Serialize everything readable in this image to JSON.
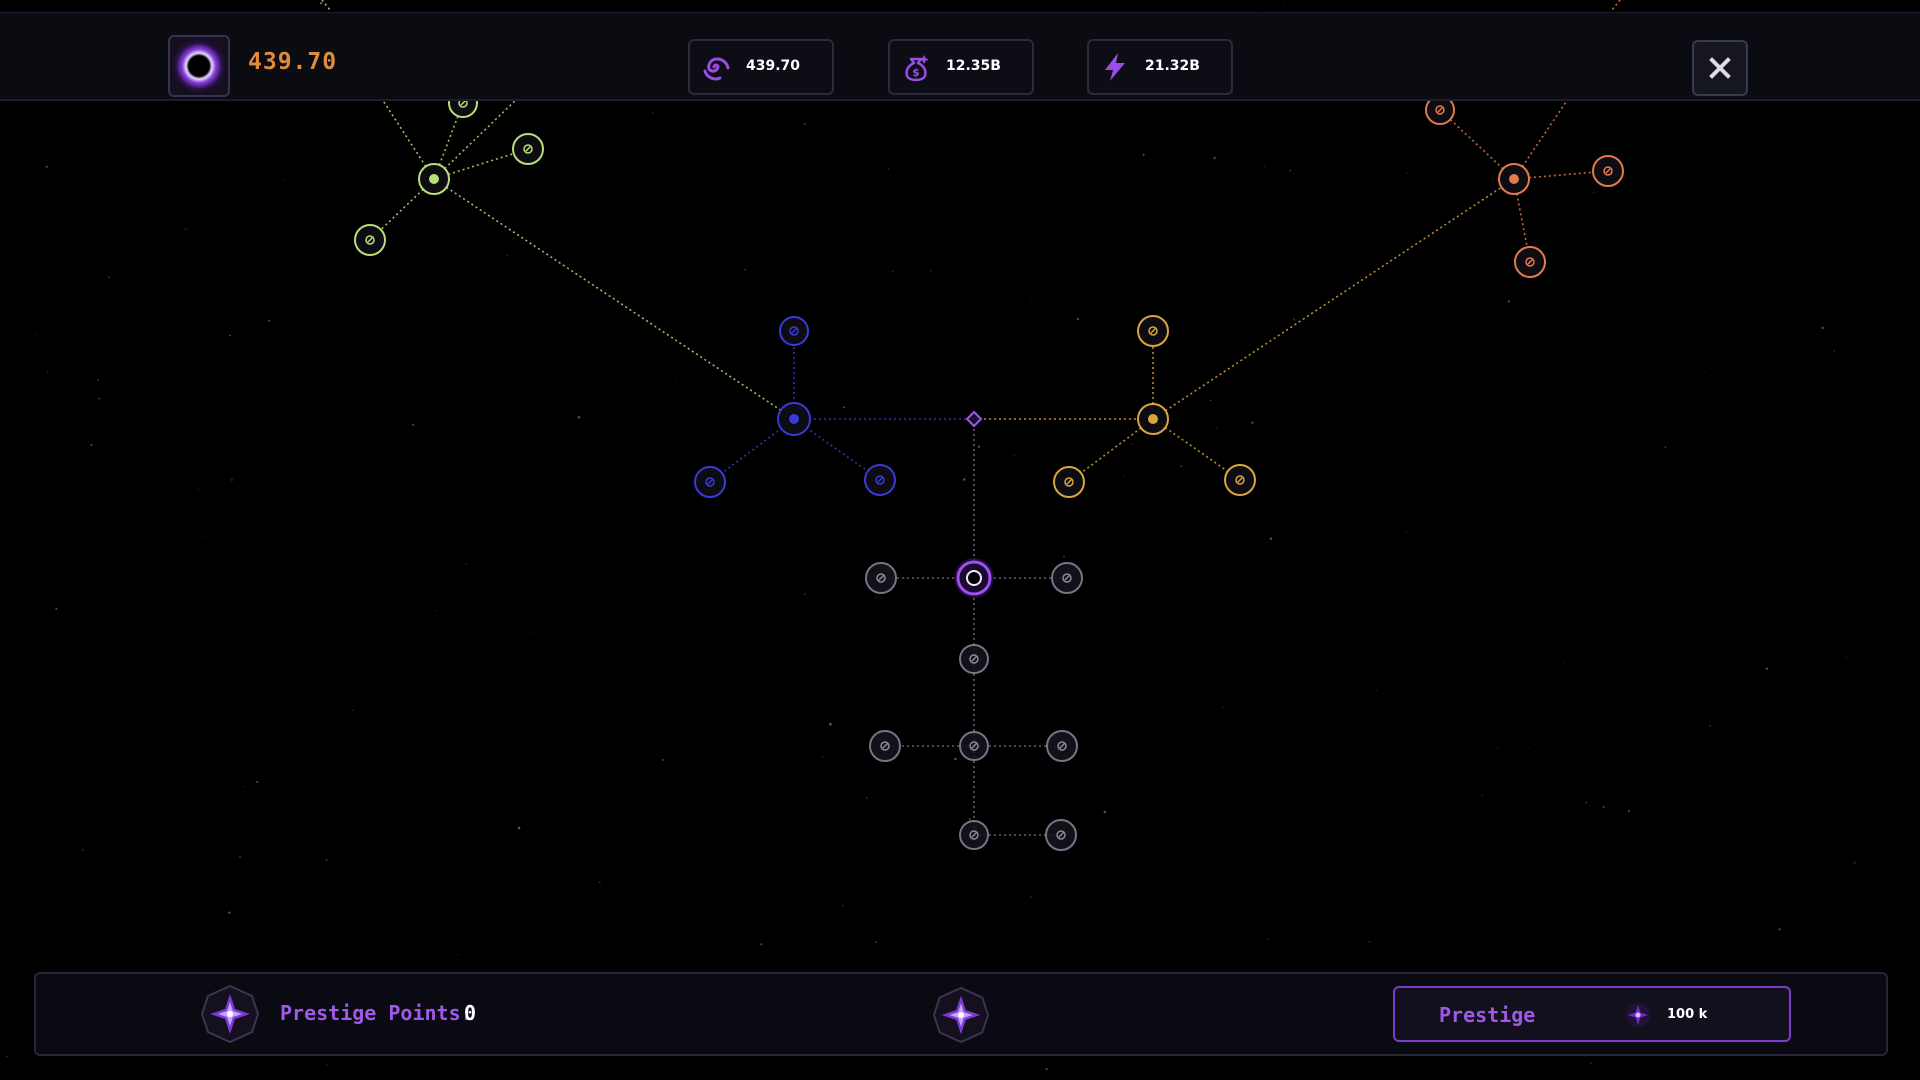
{
  "header": {
    "currency_value": "439.70",
    "resources": [
      {
        "id": "dark-matter",
        "icon": "swirl-galaxy-icon",
        "value": "439.70"
      },
      {
        "id": "money",
        "icon": "money-bag-icon",
        "value": "12.35B"
      },
      {
        "id": "energy",
        "icon": "lightning-icon",
        "value": "21.32B"
      }
    ],
    "close_icon": "close-icon"
  },
  "footer": {
    "prestige_points_label": "Prestige Points:",
    "prestige_points_value": "0",
    "prestige_button_label": "Prestige",
    "prestige_cost": "100 k"
  },
  "colors": {
    "accent_purple": "#9f58e8",
    "currency_orange": "#e08a3c",
    "branch_green": "#b8df78",
    "branch_blue": "#3a3ad8",
    "branch_gold": "#d9a63c",
    "branch_orange": "#e57a4a",
    "branch_neutral": "#8a8aa0"
  },
  "skill_tree": {
    "branches": [
      {
        "name": "green",
        "color": "#b8df78",
        "node_count": 5
      },
      {
        "name": "blue",
        "color": "#3a3ad8",
        "node_count": 4
      },
      {
        "name": "gold",
        "color": "#d9a63c",
        "node_count": 4
      },
      {
        "name": "orange",
        "color": "#e57a4a",
        "node_count": 4
      },
      {
        "name": "core",
        "color": "#8a8aa0",
        "node_count": 11
      }
    ]
  }
}
